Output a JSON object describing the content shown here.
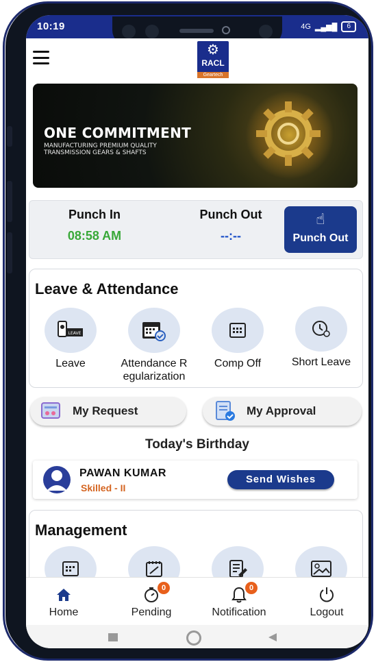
{
  "status_bar": {
    "time": "10:19",
    "network": "4G",
    "battery": "6"
  },
  "header": {
    "logo_name": "RACL",
    "logo_sub": "Geartech",
    "menu_icon": "hamburger-icon"
  },
  "banner": {
    "title": "ONE COMMITMENT",
    "subtitle_line1": "MANUFACTURING PREMIUM QUALITY",
    "subtitle_line2": "TRANSMISSION GEARS & SHAFTS"
  },
  "punch": {
    "in_label": "Punch In",
    "in_time": "08:58 AM",
    "out_label": "Punch Out",
    "out_time": "--:--",
    "button_label": "Punch Out"
  },
  "leave_attendance": {
    "title": "Leave & Attendance",
    "items": [
      {
        "label": "Leave",
        "icon": "leave-icon"
      },
      {
        "label_line1": "Attendance R",
        "label_line2": "egularization",
        "icon": "calendar-check-icon"
      },
      {
        "label": "Comp Off",
        "icon": "calendar-grid-icon"
      },
      {
        "label": "Short Leave",
        "icon": "clock-icon"
      }
    ]
  },
  "quick_actions": {
    "request_label": "My Request",
    "approval_label": "My Approval"
  },
  "birthday": {
    "title": "Today's Birthday",
    "name": "PAWAN  KUMAR",
    "role": "Skilled - II",
    "button_label": "Send Wishes"
  },
  "management": {
    "title": "Management"
  },
  "bottom_nav": {
    "items": [
      {
        "label": "Home",
        "icon": "home-icon",
        "badge": ""
      },
      {
        "label": "Pending",
        "icon": "stopwatch-icon",
        "badge": "0"
      },
      {
        "label": "Notification",
        "icon": "bell-icon",
        "badge": "0"
      },
      {
        "label": "Logout",
        "icon": "power-icon",
        "badge": ""
      }
    ]
  },
  "colors": {
    "brand_blue": "#1b3a8c",
    "status_blue": "#1a2d8c",
    "punch_in_green": "#38a838",
    "role_orange": "#d46420",
    "badge_orange": "#e8601c"
  }
}
